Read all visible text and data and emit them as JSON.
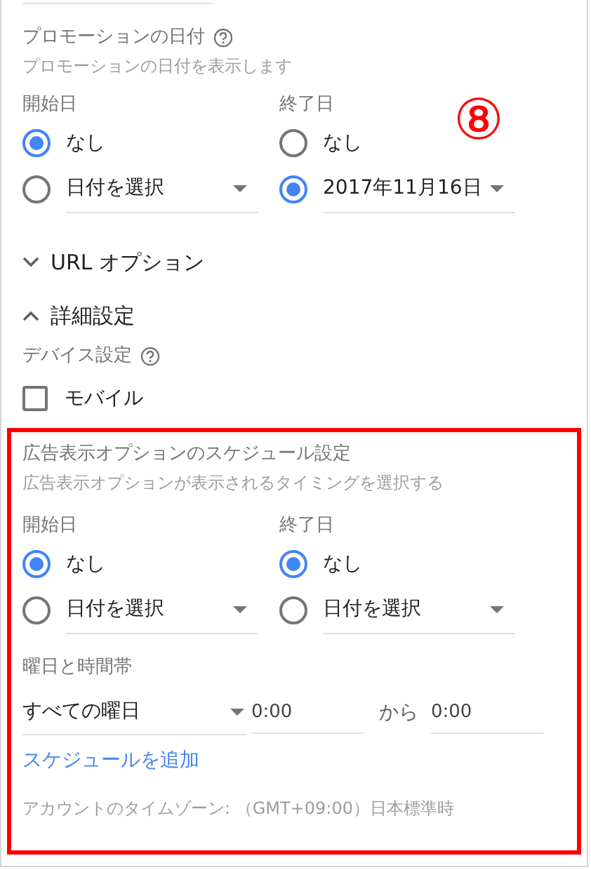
{
  "promotion_dates": {
    "title": "プロモーションの日付",
    "description": "プロモーションの日付を表示します",
    "columns": [
      {
        "label": "開始日",
        "options": [
          {
            "kind": "none",
            "label": "なし",
            "selected": true
          },
          {
            "kind": "date",
            "label": "日付を選択",
            "selected": false
          }
        ]
      },
      {
        "label": "終了日",
        "options": [
          {
            "kind": "none",
            "label": "なし",
            "selected": false
          },
          {
            "kind": "date",
            "label": "2017年11月16日",
            "selected": true
          }
        ]
      }
    ]
  },
  "annotation": "⑧",
  "url_options": {
    "label": "URL オプション",
    "expanded": false
  },
  "advanced": {
    "label": "詳細設定",
    "expanded": true
  },
  "device": {
    "title": "デバイス設定",
    "checkbox": {
      "label": "モバイル",
      "checked": false
    }
  },
  "schedule": {
    "title": "広告表示オプションのスケジュール設定",
    "description": "広告表示オプションが表示されるタイミングを選択する",
    "columns": [
      {
        "label": "開始日",
        "options": [
          {
            "kind": "none",
            "label": "なし",
            "selected": true
          },
          {
            "kind": "date",
            "label": "日付を選択",
            "selected": false
          }
        ]
      },
      {
        "label": "終了日",
        "options": [
          {
            "kind": "none",
            "label": "なし",
            "selected": true
          },
          {
            "kind": "date",
            "label": "日付を選択",
            "selected": false
          }
        ]
      }
    ],
    "days_label": "曜日と時間帯",
    "day_select": "すべての曜日",
    "start_time": "0:00",
    "connector": "から",
    "end_time": "0:00",
    "add_link": "スケジュールを追加",
    "timezone": "アカウントのタイムゾーン: （GMT+09:00）日本標準時"
  }
}
